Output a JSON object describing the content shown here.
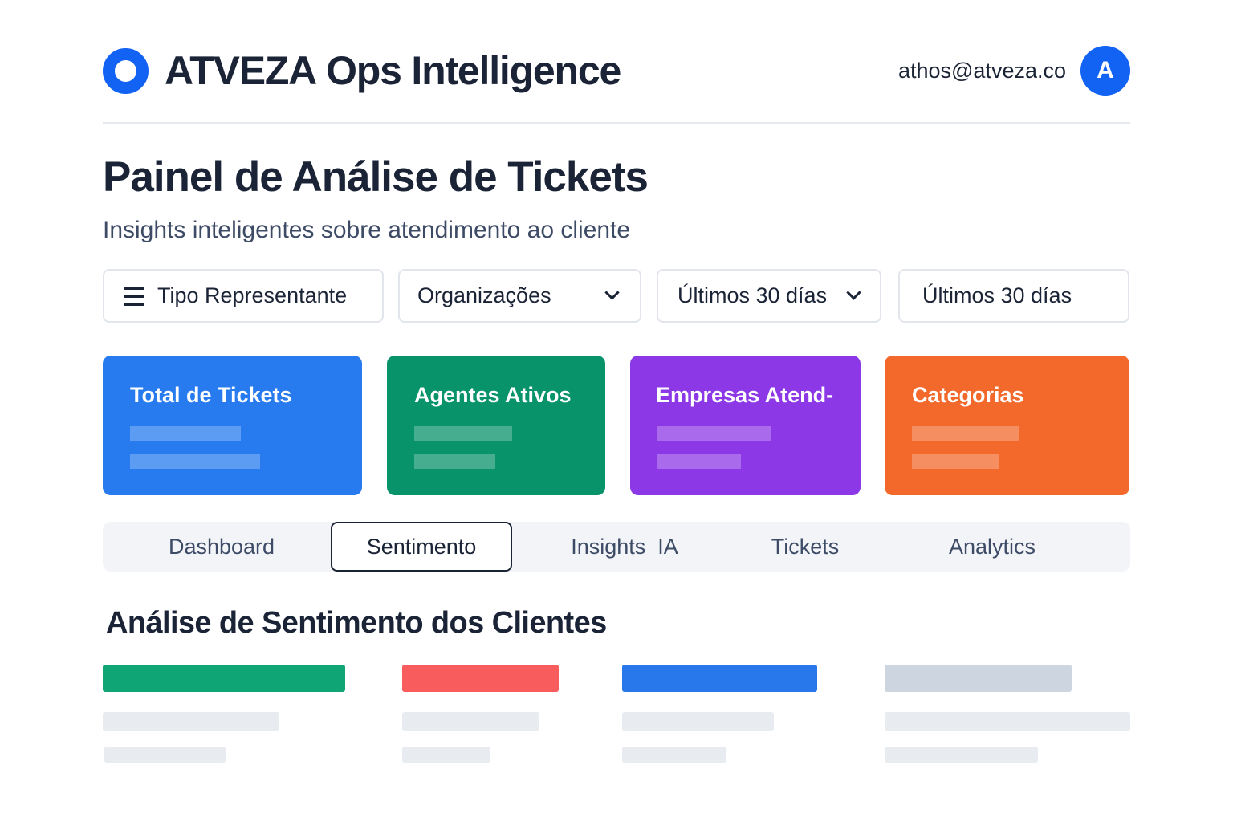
{
  "header": {
    "brand_primary": "ATVEZA",
    "brand_secondary": "Ops Intelligence",
    "user_email": "athos@atveza.co",
    "avatar_initial": "A"
  },
  "page": {
    "title": "Painel de Análise de Tickets",
    "subtitle": "Insights inteligentes sobre atendimento ao cliente"
  },
  "filters": [
    {
      "label": "Tipo Representante",
      "icon": "hamburger-icon"
    },
    {
      "label": "Organizações",
      "icon": "chevron-down-icon"
    },
    {
      "label": "Últimos 30 días",
      "icon": "chevron-down-icon"
    },
    {
      "label": "Últimos 30 días"
    }
  ],
  "kpi_cards": [
    {
      "title": "Total de Tickets",
      "color": "#277bef"
    },
    {
      "title": "Agentes Ativos",
      "color": "#08936a"
    },
    {
      "title": "Empresas Atend-",
      "color": "#8c38e6"
    },
    {
      "title": "Categorias",
      "color": "#f2692b"
    }
  ],
  "tabs": [
    {
      "label": "Dashboard",
      "active": false
    },
    {
      "label": "Sentimento",
      "active": true
    },
    {
      "label": "Insights  IA",
      "active": false
    },
    {
      "label": "Tickets",
      "active": false
    },
    {
      "label": "Analytics",
      "active": false
    }
  ],
  "section": {
    "title": "Análise de Sentimento dos Clientes"
  },
  "sentiment_colors": [
    "#0fa574",
    "#f85c5c",
    "#2878ec",
    "#cdd5e0"
  ],
  "colors": {
    "accent": "#1262f4",
    "text": "#1b2436"
  }
}
